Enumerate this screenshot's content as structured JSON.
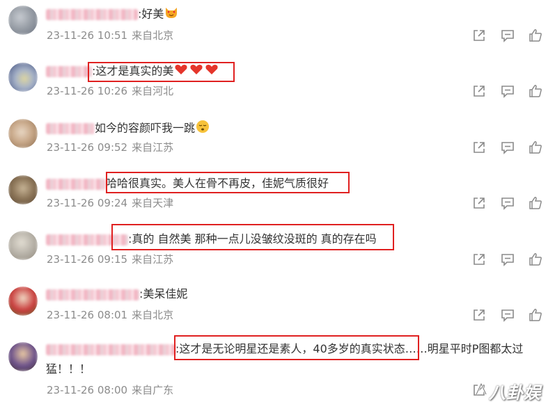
{
  "comments": [
    {
      "id": 1,
      "text": "好美",
      "emoji": "heart-eyes-cat",
      "date": "23-11-26 10:51",
      "location": "来自北京",
      "avatar_colors": [
        "#6b7280",
        "#9aa0a8",
        "#c7cbd1"
      ]
    },
    {
      "id": 2,
      "text": "这才是真实的美",
      "emoji": "three-red-hearts",
      "date": "23-11-26 10:26",
      "location": "来自河北",
      "avatar_colors": [
        "#3b4a7a",
        "#a7b3c9",
        "#ded6a0"
      ]
    },
    {
      "id": 3,
      "text": "如今的容颜吓我一跳",
      "emoji": "sleepy-face",
      "date": "23-11-26 09:52",
      "location": "来自江苏",
      "avatar_colors": [
        "#8a6a4b",
        "#c9a98a",
        "#e8d7c4"
      ]
    },
    {
      "id": 4,
      "text": "哈哈很真实。美人在骨不再皮，佳妮气质很好",
      "emoji": "",
      "date": "23-11-26 09:24",
      "location": "来自天津",
      "avatar_colors": [
        "#8a7356",
        "#c7b496",
        "#5d4a36"
      ]
    },
    {
      "id": 5,
      "text": "真的 自然美 那种一点儿没皱纹没斑的 真的存在吗",
      "emoji": "",
      "date": "23-11-26 09:15",
      "location": "来自江苏",
      "avatar_colors": [
        "#b7b2a8",
        "#e2ddd2",
        "#8f877b"
      ]
    },
    {
      "id": 6,
      "text": "美呆佳妮",
      "emoji": "",
      "date": "23-11-26 08:01",
      "location": "来自北京",
      "avatar_colors": [
        "#c83a3a",
        "#f0d9c4",
        "#5a7a3b"
      ]
    },
    {
      "id": 7,
      "text": "这才是无论明星还是素人，40多岁的真实状态……明星平时P图都太过",
      "text_line2": "猛！！！",
      "emoji": "",
      "date": "23-11-26 08:00",
      "location": "来自广东",
      "avatar_colors": [
        "#6a4f8a",
        "#e9c9a3",
        "#4a3b2c"
      ]
    }
  ],
  "separator": ":",
  "watermark": "八卦娱",
  "colors": {
    "highlight": "#e02020",
    "meta": "#8c8c8c",
    "icon": "#8a8a8a",
    "text": "#333333"
  }
}
